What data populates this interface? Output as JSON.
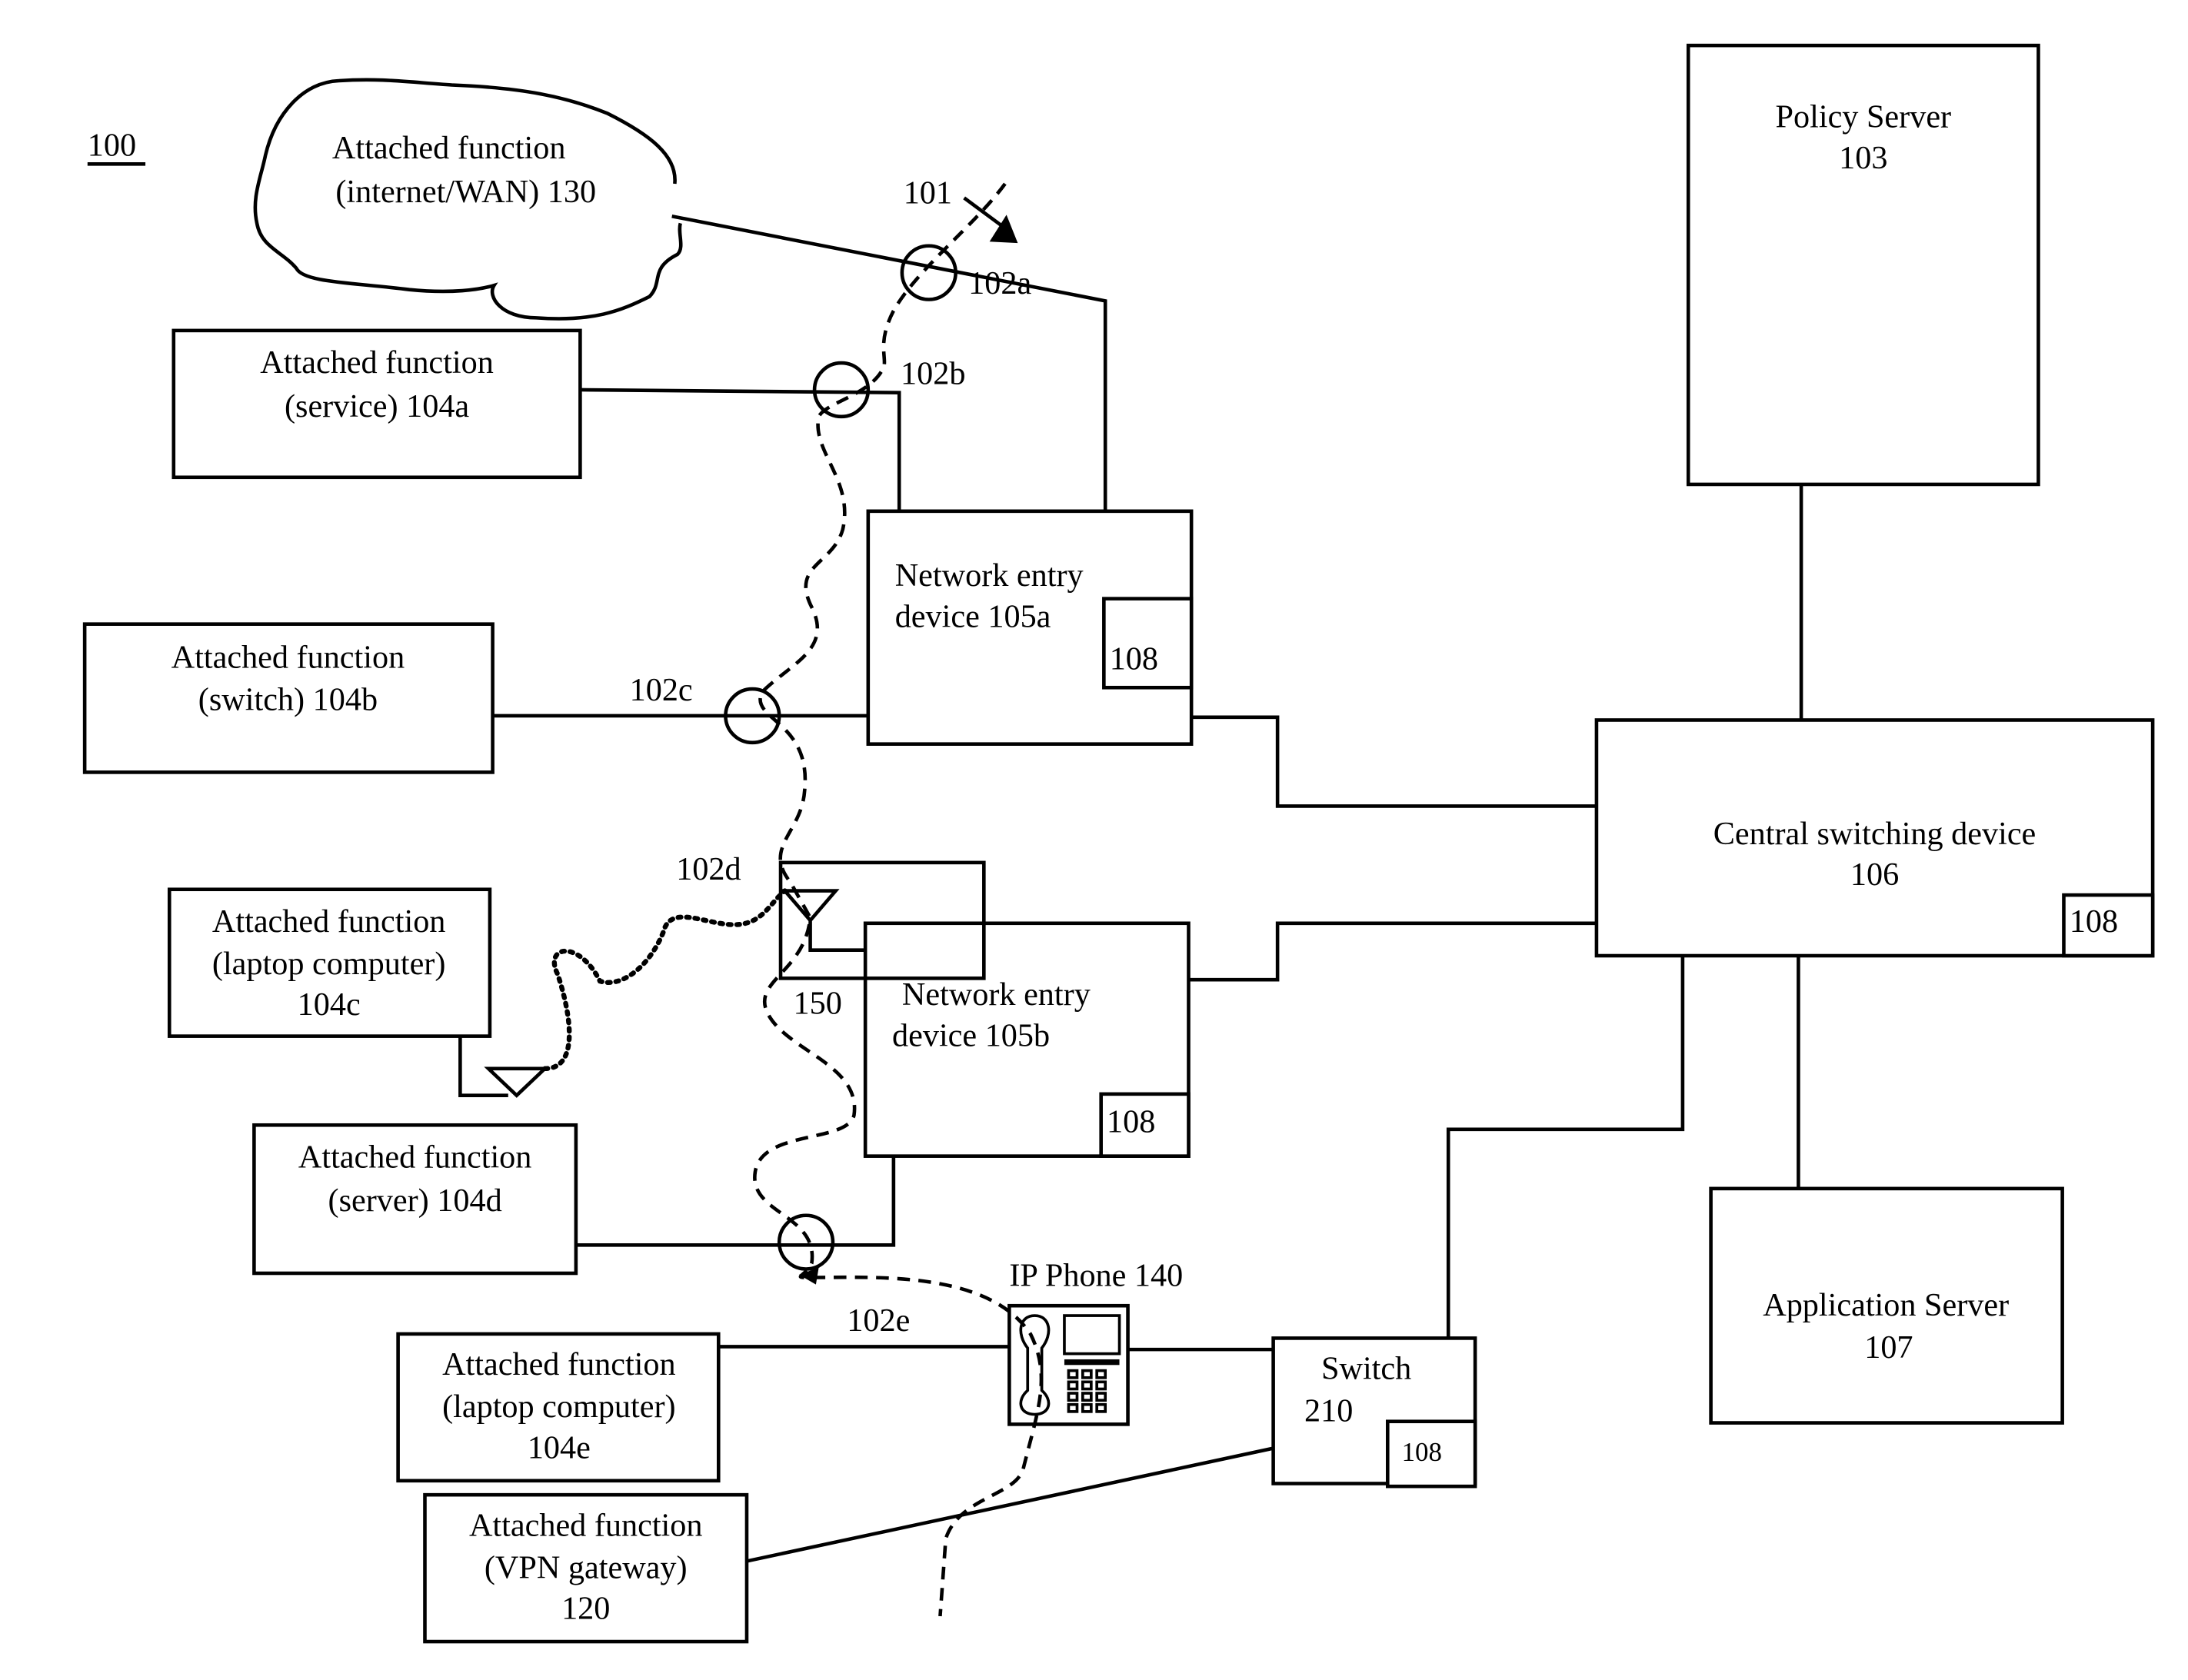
{
  "figure_label": "100",
  "nodes": {
    "internet": {
      "line1": "Attached function",
      "line2": "(internet/WAN) 130"
    },
    "service": {
      "line1": "Attached function",
      "line2": "(service) 104a"
    },
    "switch104b": {
      "line1": "Attached function",
      "line2": "(switch) 104b"
    },
    "laptop104c": {
      "line1": "Attached function",
      "line2": "(laptop computer)",
      "line3": "104c"
    },
    "server104d": {
      "line1": "Attached function",
      "line2": "(server) 104d"
    },
    "laptop104e": {
      "line1": "Attached function",
      "line2": "(laptop computer)",
      "line3": "104e"
    },
    "vpn": {
      "line1": "Attached function",
      "line2": "(VPN gateway)",
      "line3": "120"
    },
    "ned105a": {
      "line1": "Network entry",
      "line2": "device 105a",
      "tag": "108"
    },
    "ned105b": {
      "line1": "Network entry",
      "line2": "device 105b",
      "tag": "108"
    },
    "policy": {
      "line1": "Policy Server",
      "line2": "103"
    },
    "central": {
      "line1": "Central switching device",
      "line2": "106",
      "tag": "108"
    },
    "appserver": {
      "line1": "Application Server",
      "line2": "107"
    },
    "switch210": {
      "line1": "Switch",
      "line2": "210",
      "tag": "108"
    },
    "ipphone": {
      "label": "IP Phone 140"
    }
  },
  "labels": {
    "l101": "101",
    "l102a": "102a",
    "l102b": "102b",
    "l102c": "102c",
    "l102d": "102d",
    "l102e": "102e",
    "l150": "150"
  }
}
